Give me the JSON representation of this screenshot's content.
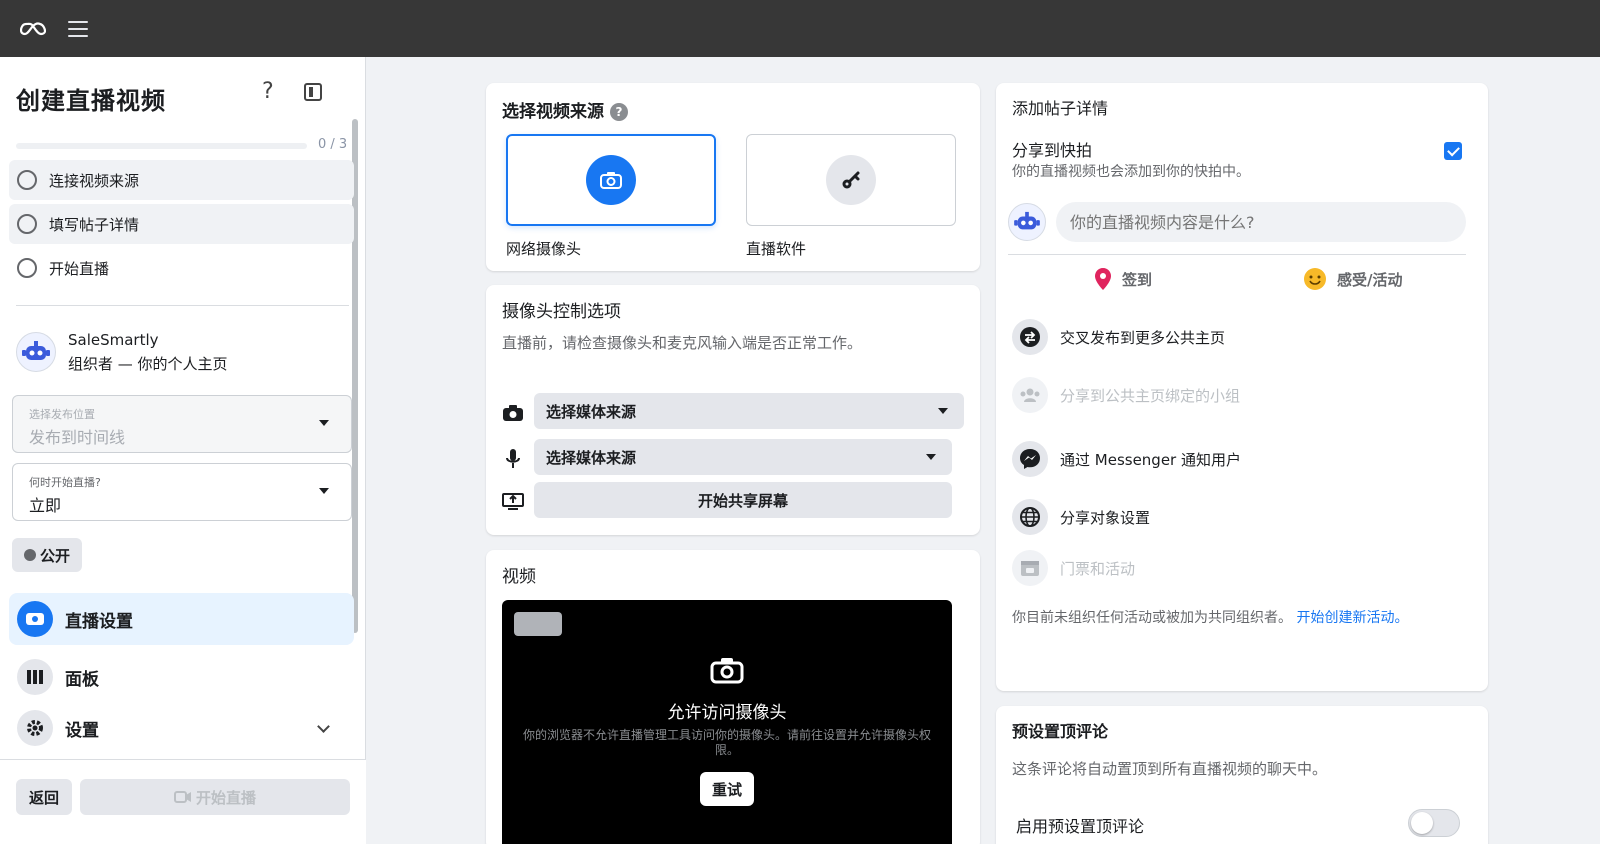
{
  "sidebar": {
    "title": "创建直播视频",
    "help": "?",
    "progress": {
      "text": "0 / 3",
      "fraction": 0
    },
    "steps": [
      {
        "label": "连接视频来源"
      },
      {
        "label": "填写帖子详情"
      },
      {
        "label": "开始直播"
      }
    ],
    "organizer": {
      "name": "SaleSmartly",
      "role": "组织者 — 你的个人主页"
    },
    "post_location": {
      "label": "选择发布位置",
      "value": "发布到时间线"
    },
    "start_time": {
      "label": "何时开始直播?",
      "value": "立即"
    },
    "audience_button": "公开",
    "nav": [
      {
        "label": "直播设置",
        "icon": "video-camera-icon"
      },
      {
        "label": "面板",
        "icon": "dashboard-icon"
      },
      {
        "label": "设置",
        "icon": "gear-icon"
      }
    ],
    "back_button": "返回",
    "go_live_button": "开始直播"
  },
  "source_card": {
    "title": "选择视频来源",
    "options": [
      {
        "label": "网络摄像头",
        "icon": "camera-icon",
        "selected": true
      },
      {
        "label": "直播软件",
        "icon": "key-icon",
        "selected": false
      }
    ]
  },
  "camera_card": {
    "title": "摄像头控制选项",
    "description": "直播前，请检查摄像头和麦克风输入端是否正常工作。",
    "camera_select": "选择媒体来源",
    "mic_select": "选择媒体来源",
    "share_screen_button": "开始共享屏幕"
  },
  "video_card": {
    "title": "视频",
    "preview_title": "允许访问摄像头",
    "preview_desc": "你的浏览器不允许直播管理工具访问你的摄像头。请前往设置并允许摄像头权限。",
    "retry_button": "重试"
  },
  "details_card": {
    "title": "添加帖子详情",
    "share_story": {
      "title": "分享到快拍",
      "subtitle": "你的直播视频也会添加到你的快拍中。",
      "checked": true
    },
    "composer_placeholder": "你的直播视频内容是什么?",
    "actions": [
      {
        "label": "签到",
        "icon": "location-pin-icon"
      },
      {
        "label": "感受/活动",
        "icon": "smiley-icon"
      }
    ],
    "options": [
      {
        "label": "交叉发布到更多公共主页",
        "enabled": true,
        "icon": "crosspost-icon"
      },
      {
        "label": "分享到公共主页绑定的小组",
        "enabled": false,
        "icon": "groups-icon"
      },
      {
        "label": "通过 Messenger 通知用户",
        "enabled": true,
        "icon": "messenger-icon"
      },
      {
        "label": "分享对象设置",
        "enabled": true,
        "icon": "globe-icon"
      },
      {
        "label": "门票和活动",
        "enabled": false,
        "icon": "ticket-icon"
      }
    ],
    "notice": "你目前未组织任何活动或被加为共同组织者。",
    "notice_link": "开始创建新活动。"
  },
  "pinned_card": {
    "title": "预设置顶评论",
    "description": "这条评论将自动置顶到所有直播视频的聊天中。",
    "toggle_label": "启用预设置顶评论",
    "toggle_on": false
  },
  "colors": {
    "accent": "#1877f2",
    "topbar": "#373737",
    "pin": "#e0245e",
    "smiley": "#f7b928"
  }
}
